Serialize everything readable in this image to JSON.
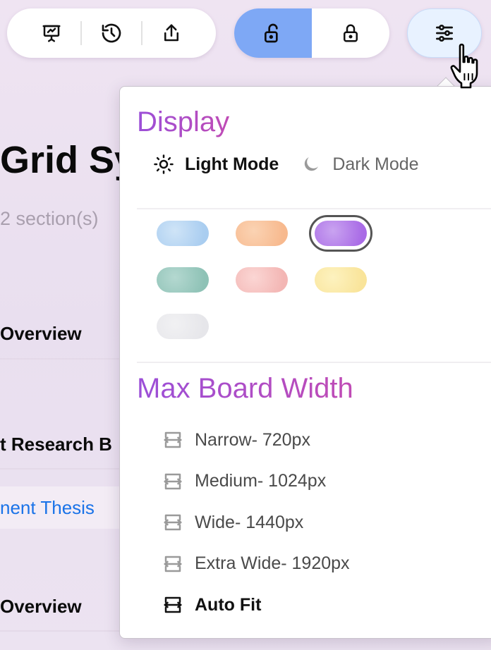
{
  "toolbar": {
    "left_buttons": [
      "presentation-icon",
      "history-icon",
      "share-icon"
    ],
    "lock_toggle": {
      "unlocked": "unlock-icon",
      "locked": "lock-icon",
      "active": "unlocked"
    },
    "settings_button": "sliders-icon"
  },
  "page": {
    "title": "Grid Sy",
    "subtitle": "2 section(s)",
    "sections": [
      "Overview",
      "t Research B",
      "Overview"
    ],
    "link": "nent Thesis"
  },
  "popover": {
    "display_heading": "Display",
    "light_mode_label": "Light Mode",
    "dark_mode_label": "Dark Mode",
    "selected_mode": "light",
    "swatches": [
      {
        "name": "sky",
        "colors": [
          "#cfe4f7",
          "#a9cdf0"
        ]
      },
      {
        "name": "peach",
        "colors": [
          "#fbd3b3",
          "#f7b98e"
        ]
      },
      {
        "name": "purple",
        "colors": [
          "#c9a3f0",
          "#a96be6"
        ],
        "selected": true
      },
      {
        "name": "teal",
        "colors": [
          "#b4d8d0",
          "#8ec2b6"
        ]
      },
      {
        "name": "rose",
        "colors": [
          "#fbd6d4",
          "#f3b6b4"
        ]
      },
      {
        "name": "lemon",
        "colors": [
          "#fdf2bf",
          "#f9e49a"
        ]
      },
      {
        "name": "mist",
        "colors": [
          "#f1f1f3",
          "#e6e6ea"
        ]
      }
    ],
    "width_heading": "Max Board Width",
    "width_options": [
      {
        "label": "Narrow- 720px",
        "active": false
      },
      {
        "label": "Medium- 1024px",
        "active": false
      },
      {
        "label": "Wide- 1440px",
        "active": false
      },
      {
        "label": "Extra Wide- 1920px",
        "active": false
      },
      {
        "label": "Auto Fit",
        "active": true
      }
    ]
  }
}
